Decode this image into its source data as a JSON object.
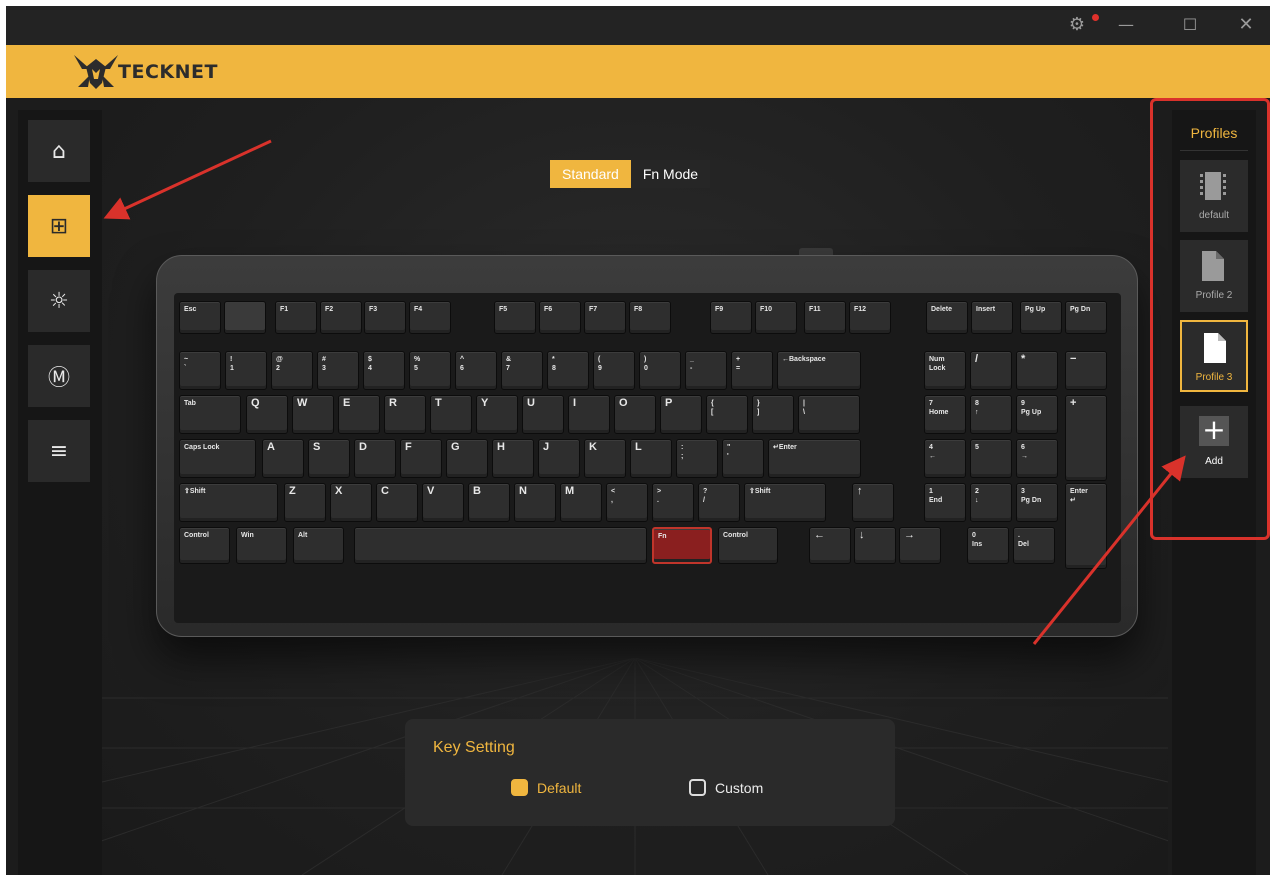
{
  "window": {
    "controls": {
      "settings_icon": "gear-icon",
      "minimize": "—",
      "maximize": "☐",
      "close": "✕"
    }
  },
  "brand": {
    "name": "TECKNET",
    "accent_color": "#f0b63f"
  },
  "left_nav": {
    "items": [
      {
        "name": "home",
        "icon": "home-icon",
        "glyph": "⌂",
        "active": false
      },
      {
        "name": "key-assign",
        "icon": "plus-square-icon",
        "glyph": "⊞",
        "active": true
      },
      {
        "name": "lighting",
        "icon": "sun-icon",
        "glyph": "☼",
        "active": false
      },
      {
        "name": "macro",
        "icon": "macro-icon",
        "glyph": "Ⓜ",
        "active": false
      },
      {
        "name": "settings-list",
        "icon": "list-icon",
        "glyph": "≡",
        "active": false
      }
    ]
  },
  "mode_toggle": {
    "standard": "Standard",
    "fn_mode": "Fn Mode",
    "selected": "Standard"
  },
  "keyboard": {
    "row_function": [
      "Esc",
      "",
      "F1",
      "F2",
      "F3",
      "F4",
      "F5",
      "F6",
      "F7",
      "F8",
      "F9",
      "F10",
      "F11",
      "F12",
      "Delete",
      "Insert",
      "Pg Up",
      "Pg Dn"
    ],
    "row_number": [
      "~\n`",
      "!\n1",
      "@\n2",
      "#\n3",
      "$\n4",
      "%\n5",
      "^\n6",
      "&\n7",
      "*\n8",
      "(\n9",
      ")\n0",
      "_\n-",
      "+\n=",
      "←Backspace",
      "Num\nLock",
      "/",
      "*",
      "−"
    ],
    "row_qwerty": [
      "Tab",
      "Q",
      "W",
      "E",
      "R",
      "T",
      "Y",
      "U",
      "I",
      "O",
      "P",
      "{\n[",
      "}\n]",
      "|\n\\",
      "7\nHome",
      "8\n↑",
      "9\nPg Up",
      "+"
    ],
    "row_home": [
      "Caps Lock",
      "A",
      "S",
      "D",
      "F",
      "G",
      "H",
      "J",
      "K",
      "L",
      ":\n;",
      "\"\n'",
      "↵Enter",
      "4\n←",
      "5",
      "6\n→"
    ],
    "row_shift": [
      "⇧Shift",
      "Z",
      "X",
      "C",
      "V",
      "B",
      "N",
      "M",
      "<\n,",
      ">\n.",
      "?\n/",
      "⇧Shift",
      "↑",
      "1\nEnd",
      "2\n↓",
      "3\nPg Dn",
      "Enter\n↵"
    ],
    "row_bottom": [
      "Control",
      "Win",
      "Alt",
      "",
      "Fn",
      "Control",
      "←",
      "↓",
      "→",
      "0\nIns",
      ".\nDel"
    ],
    "highlighted_key": "Fn"
  },
  "key_setting": {
    "title": "Key Setting",
    "options": [
      {
        "label": "Default",
        "checked": true
      },
      {
        "label": "Custom",
        "checked": false
      }
    ]
  },
  "profiles": {
    "title": "Profiles",
    "items": [
      {
        "label": "default",
        "icon": "chip-icon",
        "active": false
      },
      {
        "label": "Profile 2",
        "icon": "file-icon",
        "active": false
      },
      {
        "label": "Profile 3",
        "icon": "file-icon",
        "active": true
      }
    ],
    "add_label": "Add",
    "add_icon": "plus-icon"
  },
  "annotation_color": "#d9322b"
}
